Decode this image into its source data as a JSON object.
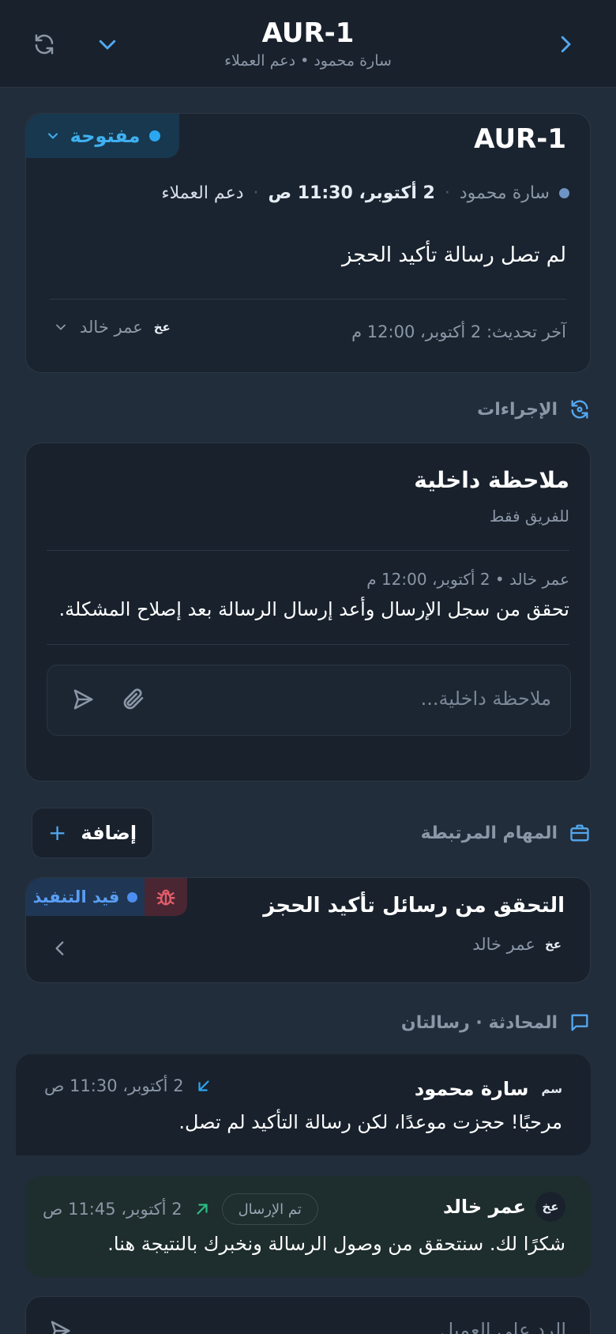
{
  "header": {
    "title": "AUR-1",
    "subtitle": "سارة محمود • دعم العملاء"
  },
  "ticket": {
    "id": "AUR-1",
    "status_label": "مفتوحة",
    "customer": "سارة محمود",
    "date": "2 أكتوبر، 11:30 ص",
    "team": "دعم العملاء",
    "subject": "لم تصل رسالة تأكيد الحجز",
    "updated": "آخر تحديث: 2 أكتوبر، 12:00 م",
    "assignee_initials": "عخ",
    "assignee_name": "عمر خالد"
  },
  "actions": {
    "title": "الإجراءات",
    "note_title": "ملاحظة داخلية",
    "note_subtitle": "للفريق فقط",
    "note_meta": "عمر خالد • 2 أكتوبر، 12:00 م",
    "note_text": "تحقق من سجل الإرسال وأعد إرسال الرسالة بعد إصلاح المشكلة.",
    "note_placeholder": "ملاحظة داخلية..."
  },
  "linked": {
    "title": "المهام المرتبطة",
    "add_label": "إضافة",
    "task_title": "التحقق من رسائل تأكيد الحجز",
    "task_status": "قيد التنفيذ",
    "task_assignee_initials": "عخ",
    "task_assignee": "عمر خالد"
  },
  "conversation": {
    "title": "المحادثة · رسالتان",
    "messages": [
      {
        "initials": "سم",
        "sender": "سارة محمود",
        "time": "2 أكتوبر، 11:30 ص",
        "text": "مرحبًا! حجزت موعدًا، لكن رسالة التأكيد لم تصل."
      },
      {
        "initials": "عخ",
        "sender": "عمر خالد",
        "badge": "تم الإرسال",
        "time": "2 أكتوبر، 11:45 ص",
        "text": "شكرًا لك. سنتحقق من وصول الرسالة ونخبرك بالنتيجة هنا."
      }
    ],
    "reply_placeholder": "الرد على العميل..."
  },
  "colors": {
    "accent_blue": "#52a8f0",
    "open_badge": "#1e6fa3",
    "bug_red": "#e35d6a",
    "sent_green": "#2ebd85"
  }
}
